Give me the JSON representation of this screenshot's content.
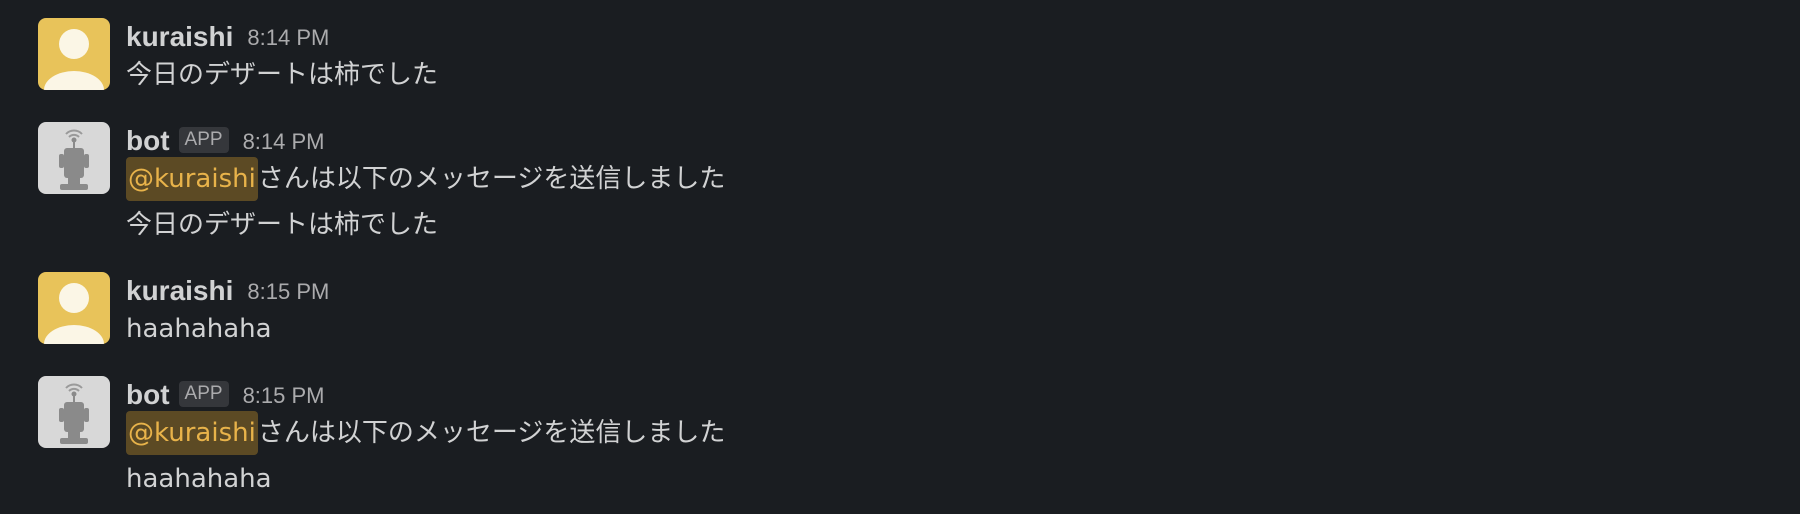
{
  "messages": [
    {
      "user": "kuraishi",
      "time": "8:14 PM",
      "lines": [
        "今日のデザートは柿でした"
      ]
    },
    {
      "user": "bot",
      "app_badge": "APP",
      "time": "8:14 PM",
      "mention": "@kuraishi",
      "mention_suffix": "さんは以下のメッセージを送信しました",
      "body": "今日のデザートは柿でした"
    },
    {
      "user": "kuraishi",
      "time": "8:15 PM",
      "lines": [
        "haahahaha"
      ]
    },
    {
      "user": "bot",
      "app_badge": "APP",
      "time": "8:15 PM",
      "mention": "@kuraishi",
      "mention_suffix": "さんは以下のメッセージを送信しました",
      "body": "haahahaha"
    }
  ],
  "colors": {
    "background": "#1a1d21",
    "text": "#d1d2d3",
    "muted": "#ababad",
    "mention_bg": "#5c4a24",
    "mention_text": "#e8b34a",
    "user_avatar_bg": "#e8c35a",
    "bot_avatar_bg": "#d8d8d8"
  },
  "icons": {
    "user_avatar": "person-silhouette-icon",
    "bot_avatar": "robot-antenna-icon"
  }
}
